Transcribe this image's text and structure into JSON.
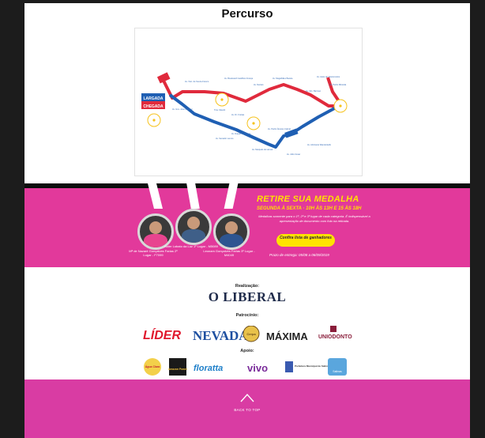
{
  "section": {
    "title": "Percurso"
  },
  "map": {
    "start_label_1": "LARGADA",
    "start_label_2": "CHEGADA",
    "streets": [
      "Av. Visc. de Souza Franco",
      "Av. Gov. José Malcher",
      "Av. Boulevard Castilhos França",
      "Av. Nazaré",
      "Av. Magalhães Barata",
      "Av. Assis de Vasconcelos",
      "Av. Pedro Miranda",
      "Av. Alm. Barroso",
      "Trav. Mauriti",
      "Av. Dr. Freitas",
      "Av. Duque de Caxias",
      "Av. Pedro Álvares Cabral",
      "Av. Senador Lemos",
      "Av. Marquês de Herval",
      "Av. Júlio César",
      "Av. Almirante Wandenkolk"
    ],
    "water_labels": [
      "Posto de Água",
      "Posto de Água",
      "Posto de Água",
      "Posto de Água"
    ],
    "colors": {
      "red": "#e02a3c",
      "blue": "#1f5fb3",
      "yellow": "#f6c21c"
    }
  },
  "banner": {
    "title": "RETIRE SUA MEDALHA",
    "subtitle": "SEGUNDA À SEXTA · 10H ÀS 13H E 15 ÀS 18H",
    "text": "Medalhas somente para o 1º, 2º e 3º lugar de cada categoria. É indispensável a apresentação de documento com foto na retirada.",
    "button": "Confira lista de ganhadores",
    "date": "Prazo de entrega: 05/08 a 06/09/2019",
    "athletes": [
      {
        "caption": "Mª de Nazaré Gonçalves Farias 2º Lugar - F7099"
      },
      {
        "caption": "Alder Lobato da Luz 1º Lugar - M5089"
      },
      {
        "caption": "Leonam Gonçalves Farias 3º Lugar - M4049"
      }
    ]
  },
  "sponsors": {
    "realizacao_label": "Realização:",
    "realizacao_logo": "O LIBERAL",
    "patrocinio_label": "Patrocínio:",
    "patrocinio": [
      "LÍDER",
      "NEVADA",
      "Cerpa",
      "MÁXIMA",
      "UNIODONTO"
    ],
    "apoio_label": "Apoio:",
    "apoio": [
      "Água Clara",
      "Amazon Power",
      "floratta",
      "vivo",
      "Prefeitura Municipal de Salinópolis",
      "Salinas"
    ]
  },
  "footer": {
    "back_to_top": "BACK TO TOP"
  }
}
